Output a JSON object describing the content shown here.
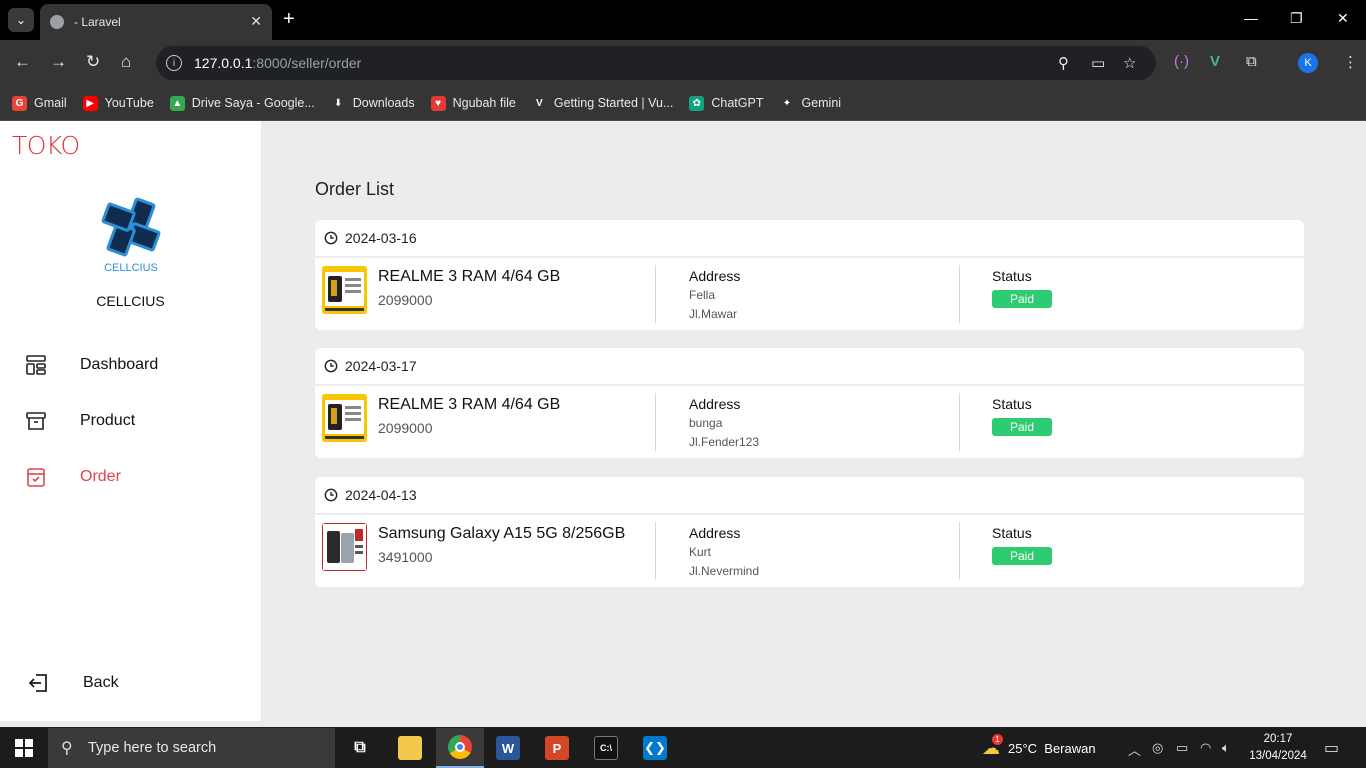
{
  "browser": {
    "tab_title": "- Laravel",
    "url_host": "127.0.0.1",
    "url_rest": ":8000/seller/order",
    "profile_initial": "K",
    "bookmarks": [
      {
        "label": "Gmail",
        "color": "#ea4335",
        "glyph": "G"
      },
      {
        "label": "YouTube",
        "color": "#ff0000",
        "glyph": "▶"
      },
      {
        "label": "Drive Saya - Google...",
        "color": "#34a853",
        "glyph": "▲"
      },
      {
        "label": "Downloads",
        "color": "#353535",
        "glyph": "⬇"
      },
      {
        "label": "Ngubah file",
        "color": "#e53935",
        "glyph": "♥"
      },
      {
        "label": "Getting Started | Vu...",
        "color": "#353535",
        "glyph": "V"
      },
      {
        "label": "ChatGPT",
        "color": "#10a37f",
        "glyph": "✿"
      },
      {
        "label": "Gemini",
        "color": "#353535",
        "glyph": "✦"
      }
    ]
  },
  "sidebar": {
    "brand": "TOKO",
    "store_name": "CELLCIUS",
    "logo_text": "CELLCIUS",
    "menu": [
      {
        "label": "Dashboard",
        "icon": "dashboard-icon",
        "active": false
      },
      {
        "label": "Product",
        "icon": "archive-box-icon",
        "active": false
      },
      {
        "label": "Order",
        "icon": "order-icon",
        "active": true
      }
    ],
    "back_label": "Back"
  },
  "main": {
    "title": "Order List",
    "address_label": "Address",
    "status_label": "Status",
    "orders": [
      {
        "date": "2024-03-16",
        "product": "REALME 3 RAM 4/64 GB",
        "price": "2099000",
        "name": "Fella",
        "street": "Jl.Mawar",
        "status": "Paid",
        "thumb": "realme"
      },
      {
        "date": "2024-03-17",
        "product": "REALME 3 RAM 4/64 GB",
        "price": "2099000",
        "name": "bunga",
        "street": "Jl.Fender123",
        "status": "Paid",
        "thumb": "realme"
      },
      {
        "date": "2024-04-13",
        "product": "Samsung Galaxy A15 5G 8/256GB",
        "price": "3491000",
        "name": "Kurt",
        "street": "Jl.Nevermind",
        "status": "Paid",
        "thumb": "samsung"
      }
    ]
  },
  "taskbar": {
    "search_placeholder": "Type here to search",
    "weather_temp": "25°C",
    "weather_desc": "Berawan",
    "weather_badge": "1",
    "time": "20:17",
    "date": "13/04/2024"
  },
  "colors": {
    "accent": "#e0454b",
    "paid_badge": "#2ecc71"
  }
}
